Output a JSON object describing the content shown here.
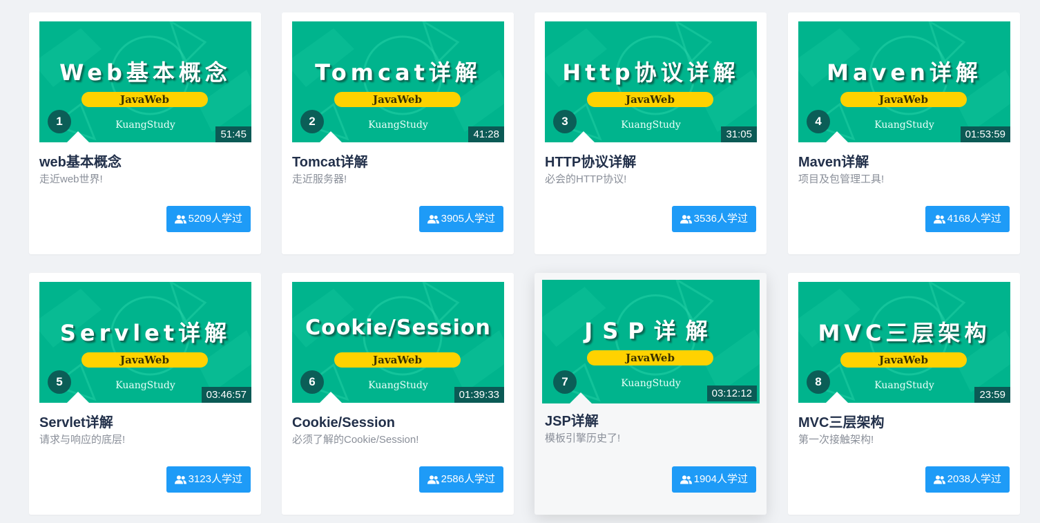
{
  "courses": [
    {
      "index": "1",
      "thumb_title": "Web基本概念",
      "thumb_tag": "JavaWeb",
      "thumb_brand": "KuangStudy",
      "duration": "51:45",
      "title": "web基本概念",
      "desc": "走近web世界!",
      "learners": "5209人学过"
    },
    {
      "index": "2",
      "thumb_title": "Tomcat详解",
      "thumb_tag": "JavaWeb",
      "thumb_brand": "KuangStudy",
      "duration": "41:28",
      "title": "Tomcat详解",
      "desc": "走近服务器!",
      "learners": "3905人学过"
    },
    {
      "index": "3",
      "thumb_title": "Http协议详解",
      "thumb_tag": "JavaWeb",
      "thumb_brand": "KuangStudy",
      "duration": "31:05",
      "title": "HTTP协议详解",
      "desc": "必会的HTTP协议!",
      "learners": "3536人学过"
    },
    {
      "index": "4",
      "thumb_title": "Maven详解",
      "thumb_tag": "JavaWeb",
      "thumb_brand": "KuangStudy",
      "duration": "01:53:59",
      "title": "Maven详解",
      "desc": "项目及包管理工具!",
      "learners": "4168人学过"
    },
    {
      "index": "5",
      "thumb_title": "Servlet详解",
      "thumb_tag": "JavaWeb",
      "thumb_brand": "KuangStudy",
      "duration": "03:46:57",
      "title": "Servlet详解",
      "desc": "请求与响应的底层!",
      "learners": "3123人学过"
    },
    {
      "index": "6",
      "thumb_title": "Cookie/Session",
      "thumb_tag": "JavaWeb",
      "thumb_brand": "KuangStudy",
      "duration": "01:39:33",
      "title": "Cookie/Session",
      "desc": "必须了解的Cookie/Session!",
      "learners": "2586人学过"
    },
    {
      "index": "7",
      "thumb_title": "JSP详解",
      "thumb_tag": "JavaWeb",
      "thumb_brand": "KuangStudy",
      "duration": "03:12:12",
      "title": "JSP详解",
      "desc": "模板引擎历史了!",
      "learners": "1904人学过"
    },
    {
      "index": "8",
      "thumb_title": "MVC三层架构",
      "thumb_tag": "JavaWeb",
      "thumb_brand": "KuangStudy",
      "duration": "23:59",
      "title": "MVC三层架构",
      "desc": "第一次接触架构!",
      "learners": "2038人学过"
    }
  ],
  "icons": {
    "learners_icon": "users-icon"
  },
  "colors": {
    "thumb_green": "#00b48d",
    "pill_yellow": "#ffd200",
    "button_blue": "#1e9bf7",
    "badge_dark": "#0b5e57"
  }
}
